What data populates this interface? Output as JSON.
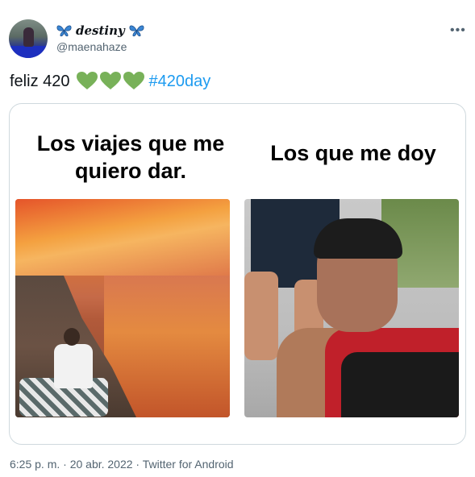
{
  "author": {
    "display_name": "destiny",
    "handle": "@maenahaze",
    "emoji_icons": [
      "butterfly-icon",
      "butterfly-icon"
    ]
  },
  "tweet": {
    "text": "feliz 420",
    "emojis": [
      "green-heart-icon",
      "green-heart-icon",
      "green-heart-icon"
    ],
    "hashtag": "#420day"
  },
  "media": {
    "caption_left": "Los viajes que me quiero dar.",
    "caption_right": "Los que me doy"
  },
  "meta": {
    "timestamp": "6:25 p. m. · 20 abr. 2022 · Twitter for Android"
  },
  "colors": {
    "link": "#1d9bf0",
    "secondary_text": "#536471",
    "heart": "#78b159",
    "butterfly": "#3a86d4"
  }
}
